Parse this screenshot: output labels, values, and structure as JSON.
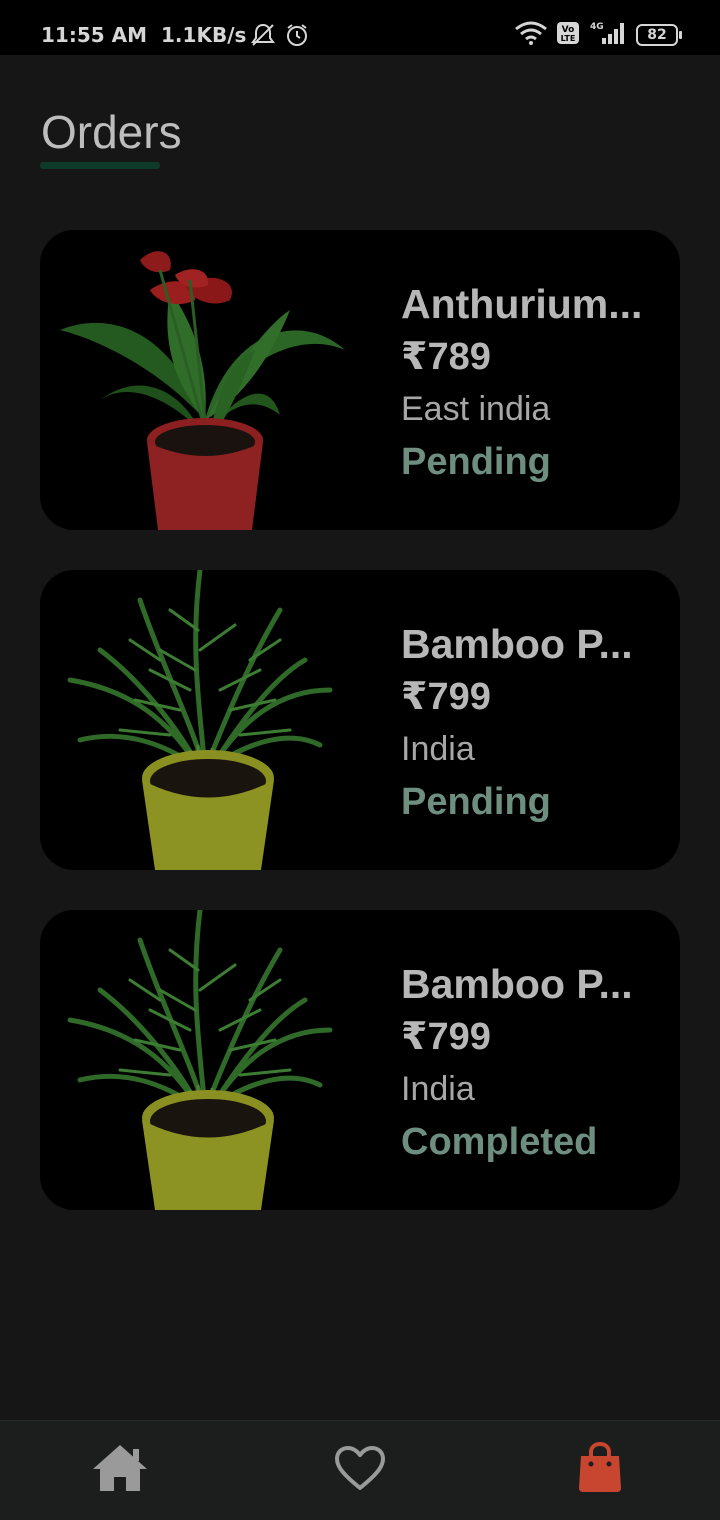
{
  "status_bar": {
    "time": "11:55 AM",
    "speed": "1.1KB/s",
    "battery": "82",
    "network": "4G",
    "volte": "Vo LTE"
  },
  "header": {
    "title": "Orders"
  },
  "colors": {
    "background": "#161616",
    "card": "#000000",
    "accent_underline": "#0e3a2a",
    "status_text": "#6e8f80",
    "cart_active": "#c8452f"
  },
  "orders": [
    {
      "name": "Anthurium...",
      "price": "₹789",
      "location": "East india",
      "status": "Pending",
      "image": "anthurium-plant-red-pot"
    },
    {
      "name": "Bamboo P...",
      "price": "₹799",
      "location": "India",
      "status": "Pending",
      "image": "bamboo-palm-yellow-pot"
    },
    {
      "name": "Bamboo P...",
      "price": "₹799",
      "location": "India",
      "status": "Completed",
      "image": "bamboo-palm-yellow-pot"
    }
  ],
  "bottom_nav": {
    "items": [
      {
        "icon": "home-icon"
      },
      {
        "icon": "heart-icon"
      },
      {
        "icon": "shopping-bag-icon",
        "active": true
      }
    ]
  }
}
